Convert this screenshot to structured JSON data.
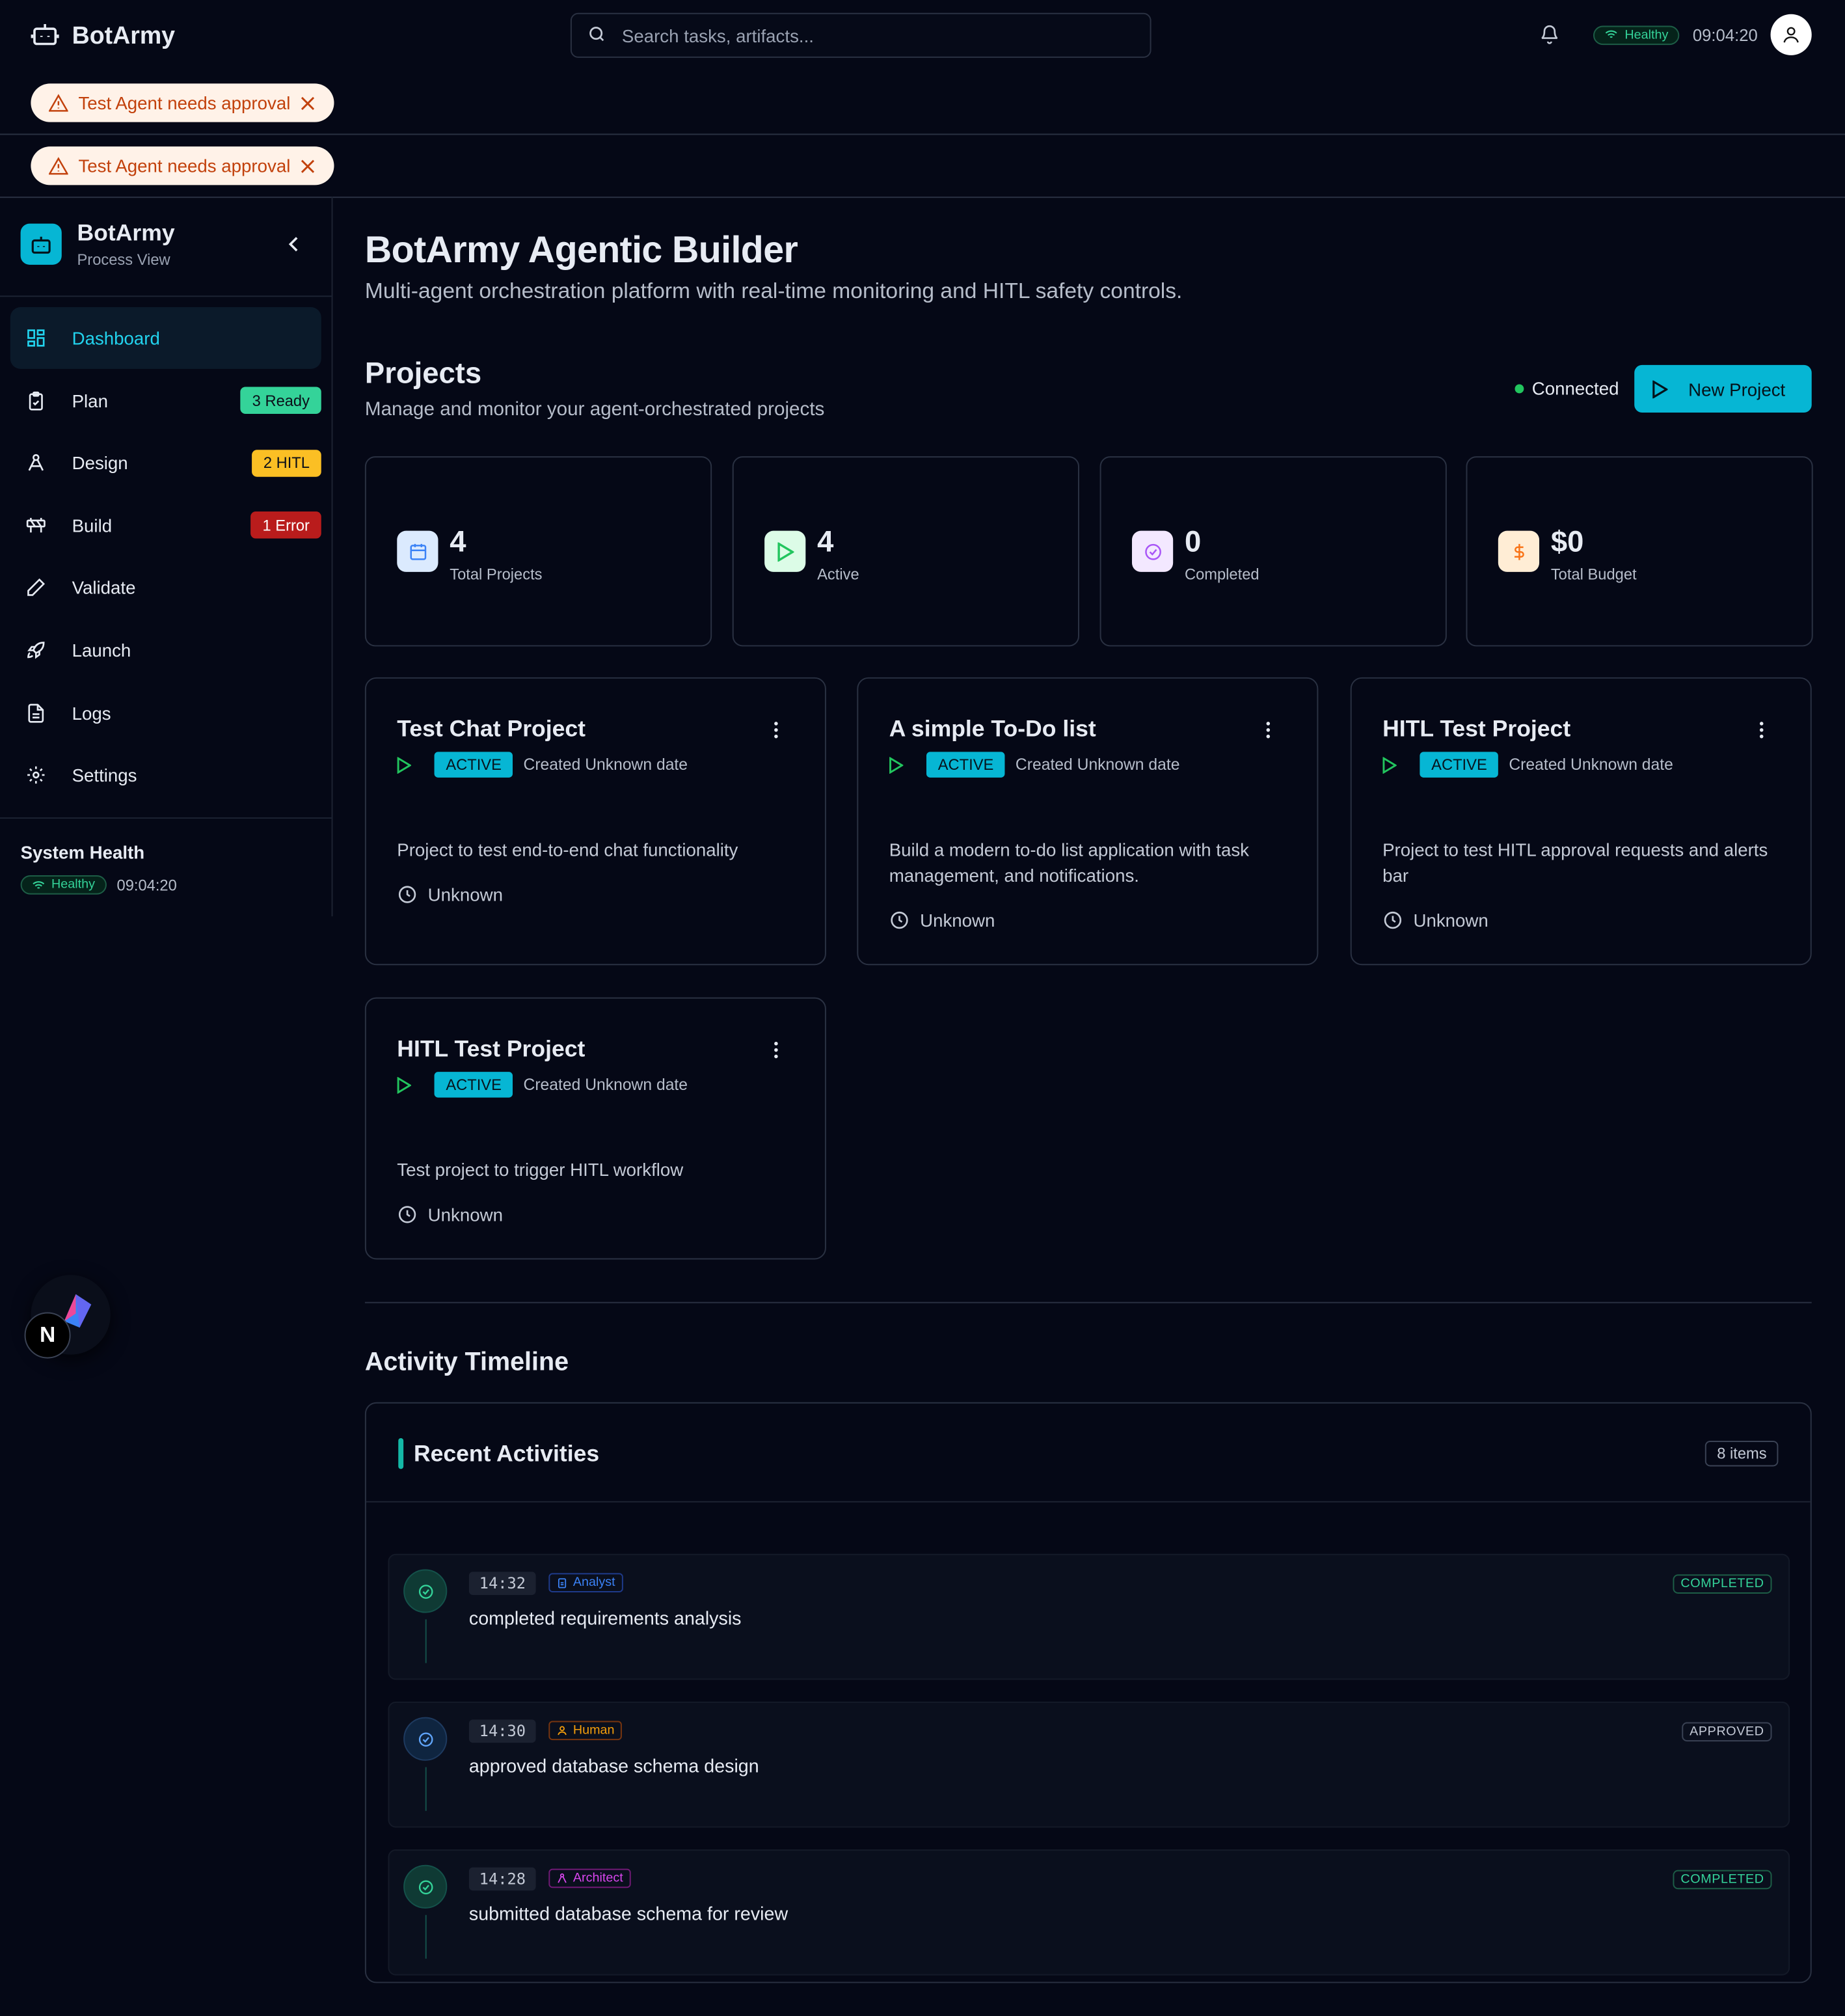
{
  "header": {
    "brand": "BotArmy",
    "search_placeholder": "Search tasks, artifacts...",
    "health": "Healthy",
    "time": "09:04:20"
  },
  "alerts": [
    {
      "text": "Test Agent needs approval"
    },
    {
      "text": "Test Agent needs approval"
    }
  ],
  "sidebar": {
    "title": "BotArmy",
    "subtitle": "Process View",
    "items": [
      {
        "label": "Dashboard",
        "icon": "dashboard-icon",
        "badge": "",
        "active": true
      },
      {
        "label": "Plan",
        "icon": "clipboard-icon",
        "badge": "3 Ready",
        "badge_color": "#34d399"
      },
      {
        "label": "Design",
        "icon": "pen-tool-icon",
        "badge": "2 HITL",
        "badge_color": "#fbbf24"
      },
      {
        "label": "Build",
        "icon": "construction-icon",
        "badge": "1 Error",
        "badge_color": "#b91c1c"
      },
      {
        "label": "Validate",
        "icon": "pencil-icon",
        "badge": ""
      },
      {
        "label": "Launch",
        "icon": "rocket-icon",
        "badge": ""
      },
      {
        "label": "Logs",
        "icon": "file-text-icon",
        "badge": ""
      },
      {
        "label": "Settings",
        "icon": "gear-icon",
        "badge": ""
      }
    ],
    "system_health": {
      "title": "System Health",
      "status": "Healthy",
      "time": "09:04:20"
    }
  },
  "main": {
    "title": "BotArmy Agentic Builder",
    "subtitle": "Multi-agent orchestration platform with real-time monitoring and HITL safety controls.",
    "projects_title": "Projects",
    "projects_subtitle": "Manage and monitor your agent-orchestrated projects",
    "connection": "Connected",
    "new_project": "New Project",
    "stats": [
      {
        "value": "4",
        "label": "Total Projects",
        "icon": "calendar-icon",
        "color": "#3b82f6"
      },
      {
        "value": "4",
        "label": "Active",
        "icon": "play-icon",
        "color": "#22c55e"
      },
      {
        "value": "0",
        "label": "Completed",
        "icon": "check-circle-icon",
        "color": "#a855f7"
      },
      {
        "value": "$0",
        "label": "Total Budget",
        "icon": "dollar-icon",
        "color": "#f97316"
      }
    ],
    "projects": [
      {
        "name": "Test Chat Project",
        "status": "ACTIVE",
        "created": "Created Unknown date",
        "description": "Project to test end-to-end chat functionality",
        "due": "Unknown"
      },
      {
        "name": "A simple To-Do list",
        "status": "ACTIVE",
        "created": "Created Unknown date",
        "description": "Build a modern to-do list application with task management, and notifications.",
        "due": "Unknown"
      },
      {
        "name": "HITL Test Project",
        "status": "ACTIVE",
        "created": "Created Unknown date",
        "description": "Project to test HITL approval requests and alerts bar",
        "due": "Unknown"
      },
      {
        "name": "HITL Test Project",
        "status": "ACTIVE",
        "created": "Created Unknown date",
        "description": "Test project to trigger HITL workflow",
        "due": "Unknown"
      }
    ],
    "timeline": {
      "section_title": "Activity Timeline",
      "card_title": "Recent Activities",
      "count": "8 items",
      "activities": [
        {
          "time": "14:32",
          "role": "Analyst",
          "role_color": "#3b82f6",
          "text": "completed requirements analysis",
          "status": "COMPLETED",
          "status_color": "#34d399"
        },
        {
          "time": "14:30",
          "role": "Human",
          "role_color": "#f59e0b",
          "text": "approved database schema design",
          "status": "APPROVED",
          "status_color": "#c4cad6"
        },
        {
          "time": "14:28",
          "role": "Architect",
          "role_color": "#d946ef",
          "text": "submitted database schema for review",
          "status": "COMPLETED",
          "status_color": "#34d399"
        }
      ]
    }
  },
  "dev_badge": "N"
}
